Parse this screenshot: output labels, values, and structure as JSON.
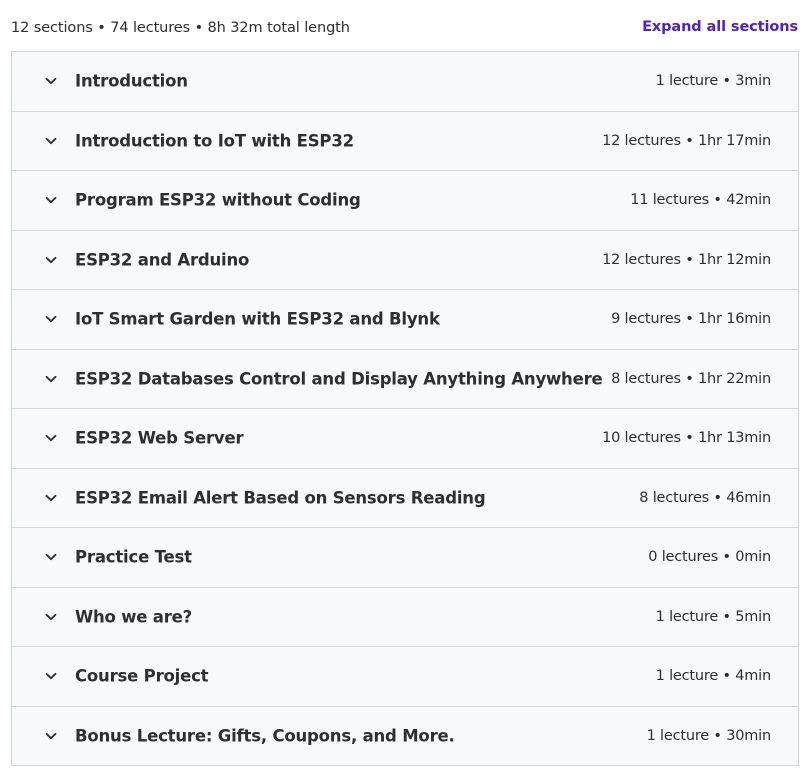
{
  "summary": {
    "text": "12 sections • 74 lectures • 8h 32m total length",
    "expand_label": "Expand all sections"
  },
  "colors": {
    "link": "#5022c3",
    "section_bg": "#f7f9fa",
    "border": "#d1d7dc",
    "text": "#2d2f31"
  },
  "icons": {
    "section_toggle": "chevron-down-icon"
  },
  "sections": [
    {
      "title": "Introduction",
      "meta": "1 lecture • 3min"
    },
    {
      "title": "Introduction to IoT with ESP32",
      "meta": "12 lectures • 1hr 17min"
    },
    {
      "title": "Program ESP32 without Coding",
      "meta": "11 lectures • 42min"
    },
    {
      "title": "ESP32 and Arduino",
      "meta": "12 lectures • 1hr 12min"
    },
    {
      "title": "IoT Smart Garden with ESP32 and Blynk",
      "meta": "9 lectures • 1hr 16min"
    },
    {
      "title": "ESP32 Databases Control and Display Anything Anywhere",
      "meta": "8 lectures • 1hr 22min"
    },
    {
      "title": "ESP32 Web Server",
      "meta": "10 lectures • 1hr 13min"
    },
    {
      "title": "ESP32 Email Alert Based on Sensors Reading",
      "meta": "8 lectures • 46min"
    },
    {
      "title": "Practice Test",
      "meta": "0 lectures • 0min"
    },
    {
      "title": "Who we are?",
      "meta": "1 lecture • 5min"
    },
    {
      "title": "Course Project",
      "meta": "1 lecture • 4min"
    },
    {
      "title": "Bonus Lecture: Gifts, Coupons, and More.",
      "meta": "1 lecture • 30min"
    }
  ]
}
